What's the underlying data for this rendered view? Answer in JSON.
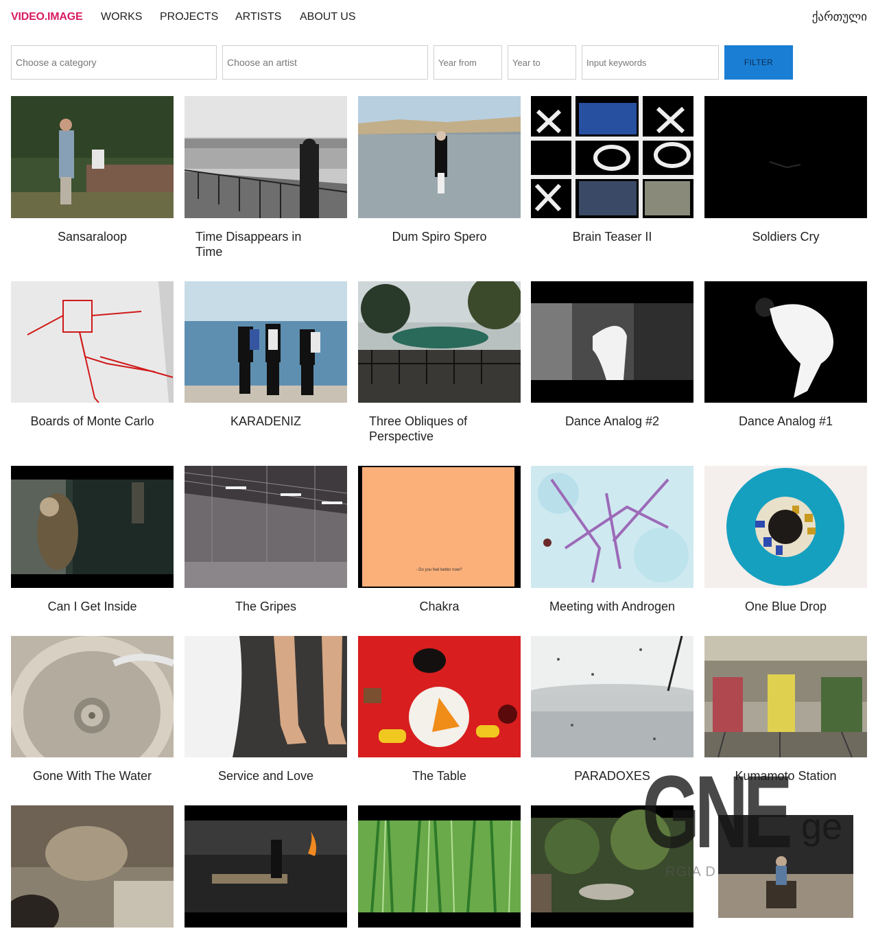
{
  "nav": {
    "brand": "VIDEO.IMAGE",
    "works": "WORKS",
    "projects": "PROJECTS",
    "artists": "ARTISTS",
    "about": "ABOUT US",
    "language": "ქართული"
  },
  "filters": {
    "category_placeholder": "Choose a category",
    "artist_placeholder": "Choose an artist",
    "year_from_placeholder": "Year from",
    "year_to_placeholder": "Year to",
    "keywords_placeholder": "Input keywords",
    "button_label": "FILTER"
  },
  "works": [
    {
      "title": "Sansaraloop"
    },
    {
      "title": "Time Disappears in Time"
    },
    {
      "title": "Dum Spiro Spero"
    },
    {
      "title": "Brain Teaser II"
    },
    {
      "title": "Soldiers Cry"
    },
    {
      "title": "Boards of Monte Carlo"
    },
    {
      "title": "KARADENIZ"
    },
    {
      "title": "Three Obliques of Perspective"
    },
    {
      "title": "Dance Analog #2"
    },
    {
      "title": "Dance Analog #1"
    },
    {
      "title": "Can I Get Inside"
    },
    {
      "title": "The Gripes"
    },
    {
      "title": "Chakra"
    },
    {
      "title": "Meeting with Androgen"
    },
    {
      "title": "One Blue Drop"
    },
    {
      "title": "Gone With The Water"
    },
    {
      "title": "Service and Love"
    },
    {
      "title": "The Table"
    },
    {
      "title": "PARADOXES"
    },
    {
      "title": "Kumamoto Station"
    },
    {
      "title": ""
    },
    {
      "title": ""
    },
    {
      "title": ""
    },
    {
      "title": ""
    },
    {
      "title": ""
    }
  ],
  "thumbnail_captions": {
    "chakra": "- Do you feel better now?"
  },
  "watermark": {
    "big": "GNE",
    "suffix": "ge",
    "sub": "RGIA D"
  },
  "colors": {
    "brand": "#d81b60",
    "filter_button": "#1a7fd4"
  }
}
